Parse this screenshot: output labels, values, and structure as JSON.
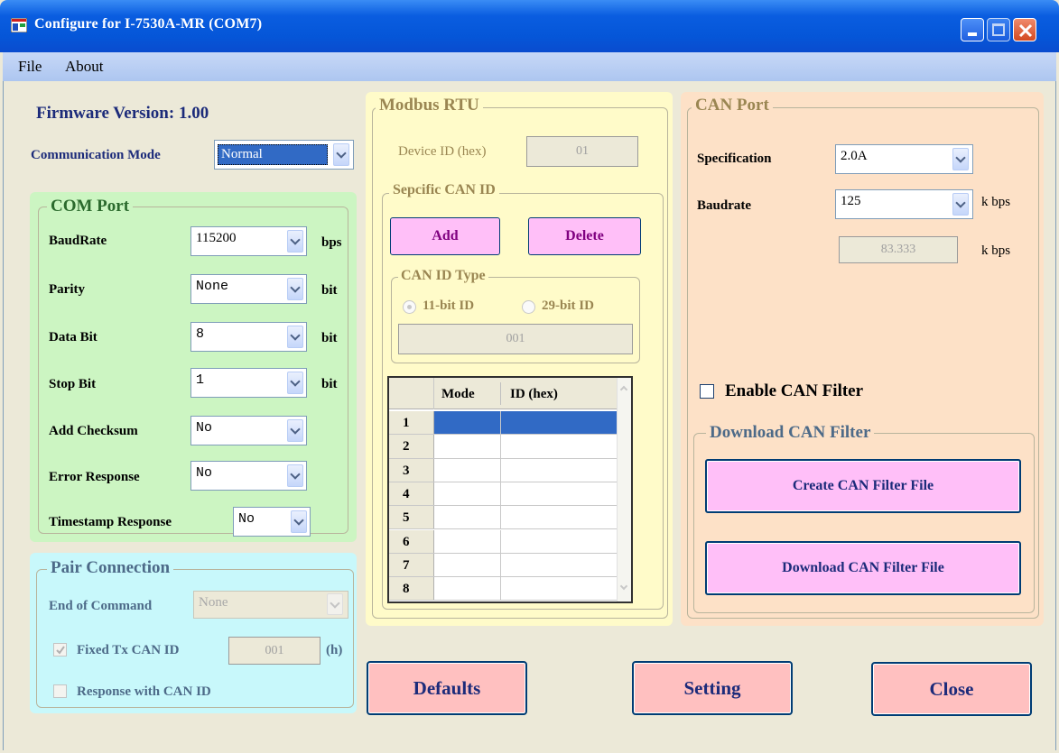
{
  "window": {
    "title": "Configure for I-7530A-MR (COM7)"
  },
  "menu": [
    "File",
    "About"
  ],
  "firmware": {
    "label": "Firmware Version:",
    "version": "1.00"
  },
  "comm_mode": {
    "label": "Communication Mode",
    "value": "Normal"
  },
  "com_port": {
    "title": "COM Port",
    "rows": [
      {
        "label": "BaudRate",
        "value": "115200",
        "unit": "bps"
      },
      {
        "label": "Parity",
        "value": "None",
        "unit": "bit"
      },
      {
        "label": "Data Bit",
        "value": "8",
        "unit": "bit"
      },
      {
        "label": "Stop Bit",
        "value": "1",
        "unit": "bit"
      },
      {
        "label": "Add Checksum",
        "value": "No",
        "unit": ""
      },
      {
        "label": "Error Response",
        "value": "No",
        "unit": ""
      },
      {
        "label": "Timestamp Response",
        "value": "No",
        "unit": ""
      }
    ]
  },
  "pair": {
    "title": "Pair Connection",
    "eoc_label": "End of Command",
    "eoc_value": "None",
    "fixed_label": "Fixed Tx CAN ID",
    "fixed_value": "001",
    "fixed_unit": "(h)",
    "fixed_checked": true,
    "resp_label": "Response with CAN ID",
    "resp_checked": false
  },
  "modbus": {
    "title": "Modbus RTU",
    "device_label": "Device ID (hex)",
    "device_value": "01",
    "specific": {
      "title": "Sepcific CAN ID",
      "add": "Add",
      "delete": "Delete",
      "id_type": {
        "title": "CAN ID Type",
        "opt11": "11-bit ID",
        "opt29": "29-bit ID",
        "selected": "11-bit ID",
        "value": "001"
      },
      "table": {
        "headers": [
          "Mode",
          "ID (hex)"
        ],
        "rows": [
          "1",
          "2",
          "3",
          "4",
          "5",
          "6",
          "7",
          "8"
        ],
        "selected_row": "1"
      }
    }
  },
  "can_port": {
    "title": "CAN Port",
    "spec_label": "Specification",
    "spec_value": "2.0A",
    "baud_label": "Baudrate",
    "baud_value": "125",
    "baud_unit": "k bps",
    "baud_custom": "83.333",
    "baud_custom_unit": "k bps",
    "enable_filter_label": "Enable CAN Filter",
    "enable_filter_checked": false,
    "download": {
      "title": "Download CAN Filter",
      "create_btn": "Create CAN Filter File",
      "download_btn": "Download CAN Filter File"
    }
  },
  "footer": {
    "defaults": "Defaults",
    "setting": "Setting",
    "close": "Close"
  },
  "colors": {
    "com_port_bg": "#ccf5c2",
    "pair_bg": "#c8f8fb",
    "modbus_bg": "#fffbc9",
    "can_bg": "#fde1c7",
    "pink_btn": "#ffbff8",
    "red_btn": "#ffc0c0",
    "title_navy": "#1c2b7a",
    "green_title": "#2b6a2d",
    "gold_title": "#9a8652",
    "purple_text": "#800080"
  }
}
